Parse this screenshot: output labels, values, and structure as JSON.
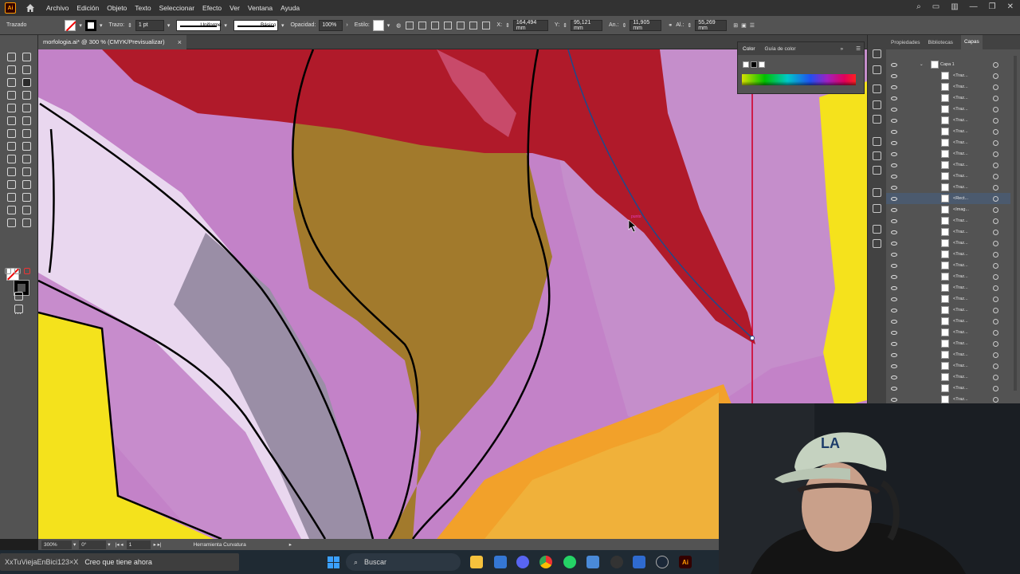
{
  "menubar": {
    "logo": "Ai",
    "items": [
      "Archivo",
      "Edición",
      "Objeto",
      "Texto",
      "Seleccionar",
      "Efecto",
      "Ver",
      "Ventana",
      "Ayuda"
    ]
  },
  "controlbar": {
    "object_type": "Trazado",
    "stroke_label": "Trazo:",
    "stroke_weight": "1 pt",
    "profile": "Uniforme",
    "brush": "Básico",
    "opacity_label": "Opacidad:",
    "opacity": "100%",
    "style_label": "Estilo:",
    "x_label": "X:",
    "x": "164,494 mm",
    "y_label": "Y:",
    "y": "95,121 mm",
    "w_label": "An.:",
    "w": "11,905 mm",
    "h": "55,269 mm"
  },
  "document_tab": {
    "title": "morfologia.ai* @ 300 % (CMYK/Previsualizar)",
    "close": "×"
  },
  "color_panel": {
    "tabs": [
      "Color",
      "Guía de color"
    ],
    "active_tab": "Color"
  },
  "layers_panel": {
    "tabs": [
      "Propiedades",
      "Bibliotecas",
      "Capas"
    ],
    "active_tab": "Capas",
    "layer_name": "Capa 1",
    "rows": [
      "<Traz...",
      "<Traz...",
      "<Traz...",
      "<Traz...",
      "<Traz...",
      "<Traz...",
      "<Traz...",
      "<Traz...",
      "<Traz...",
      "<Traz...",
      "<Traz...",
      "<Rect...",
      "<Imag...",
      "<Traz...",
      "<Traz...",
      "<Traz...",
      "<Traz...",
      "<Traz...",
      "<Traz...",
      "<Traz...",
      "<Traz...",
      "<Traz...",
      "<Traz...",
      "<Traz...",
      "<Traz...",
      "<Traz...",
      "<Traz...",
      "<Traz...",
      "<Traz...",
      "<Traz..."
    ],
    "selected_index": 11
  },
  "statusbar": {
    "zoom": "300%",
    "rotation": "0°",
    "artboard": "1",
    "tool": "Herramienta Curvatura"
  },
  "canvas": {
    "cursor_hint": "punto"
  },
  "taskbar": {
    "toast_user": "XxTuViejaEnBici123×X",
    "toast_message": "Creo que tiene ahora",
    "search_placeholder": "Buscar",
    "app_label": "Ai"
  }
}
